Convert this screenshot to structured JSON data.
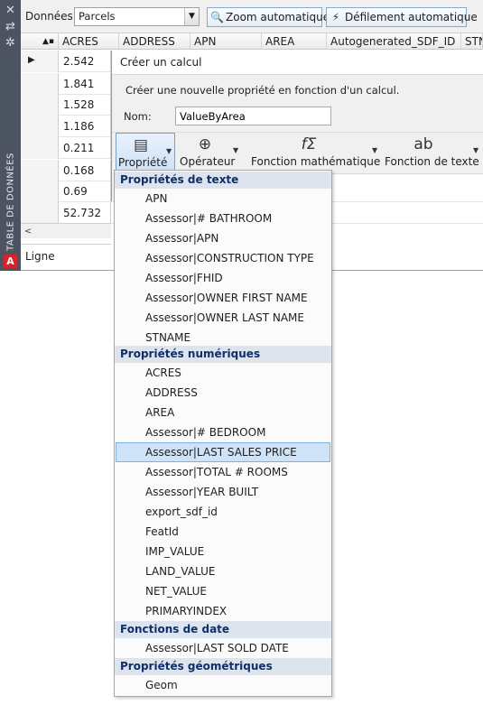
{
  "palette": {
    "vertical_title": "TABLE DE DONNÉES",
    "toolbar": {
      "data_label": "Données:",
      "data_source": "Parcels",
      "zoom_button": "Zoom automatique",
      "scroll_button": "Défilement automatique"
    },
    "columns": [
      "ACRES",
      "ADDRESS",
      "APN",
      "AREA",
      "Autogenerated_SDF_ID",
      "STN"
    ],
    "acres_values": [
      "2.542",
      "1.841",
      "1.528",
      "1.186",
      "0.211",
      "0.168",
      "0.69",
      "52.732"
    ],
    "status_label": "Ligne",
    "scroll_left": "<"
  },
  "calc_dialog": {
    "title": "Créer un calcul",
    "description": "Créer une nouvelle propriété en fonction d'un calcul.",
    "name_label": "Nom:",
    "name_value": "ValueByArea",
    "ribbon": {
      "property": "Propriété",
      "operator": "Opérateur",
      "math_function": "Fonction mathématique",
      "text_function": "Fonction de texte"
    }
  },
  "menu": {
    "text_properties": {
      "header": "Propriétés de texte",
      "items": [
        "APN",
        "Assessor|# BATHROOM",
        "Assessor|APN",
        "Assessor|CONSTRUCTION TYPE",
        "Assessor|FHID",
        "Assessor|OWNER FIRST NAME",
        "Assessor|OWNER LAST NAME",
        "STNAME"
      ]
    },
    "numeric_properties": {
      "header": "Propriétés numériques",
      "items": [
        "ACRES",
        "ADDRESS",
        "AREA",
        "Assessor|# BEDROOM",
        "Assessor|LAST SALES PRICE",
        "Assessor|TOTAL # ROOMS",
        "Assessor|YEAR BUILT",
        "export_sdf_id",
        "FeatId",
        "IMP_VALUE",
        "LAND_VALUE",
        "NET_VALUE",
        "PRIMARYINDEX"
      ],
      "selected": "Assessor|LAST SALES PRICE"
    },
    "date_functions": {
      "header": "Fonctions de date",
      "items": [
        "Assessor|LAST SOLD DATE"
      ]
    },
    "geometric_properties": {
      "header": "Propriétés géométriques",
      "items": [
        "Geom"
      ]
    }
  },
  "icons": {
    "close": "close-icon",
    "pin": "pin-icon",
    "settings": "settings-icon",
    "autodesk": "autodesk-logo-icon"
  },
  "colors": {
    "strip": "#4d5461",
    "group_header_bg": "#dde4ee",
    "group_header_text": "#0f2f68",
    "selection": "#cfe3f8"
  }
}
